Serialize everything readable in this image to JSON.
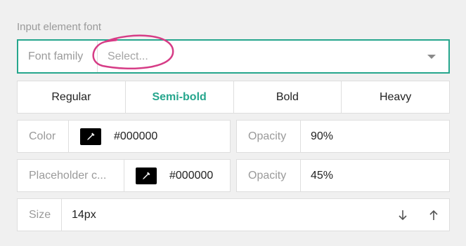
{
  "section_label": "Input element font",
  "font_family": {
    "label": "Font family",
    "value": "Select..."
  },
  "weights": [
    "Regular",
    "Semi-bold",
    "Bold",
    "Heavy"
  ],
  "active_weight": "Semi-bold",
  "color": {
    "label": "Color",
    "hex": "#000000",
    "opacity_label": "Opacity",
    "opacity": "90%"
  },
  "placeholder_color": {
    "label": "Placeholder c...",
    "hex": "#000000",
    "opacity_label": "Opacity",
    "opacity": "45%"
  },
  "size": {
    "label": "Size",
    "value": "14px"
  },
  "colors": {
    "accent": "#26a68d",
    "annotation": "#d63c86",
    "swatch": "#000000"
  }
}
